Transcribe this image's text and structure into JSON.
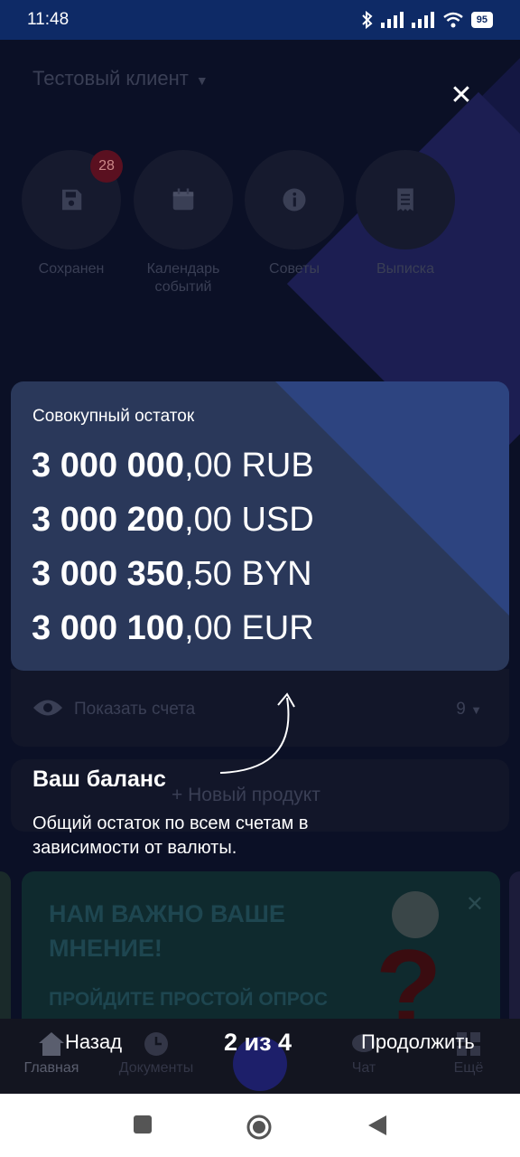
{
  "status_bar": {
    "time": "11:48",
    "battery": "95"
  },
  "header": {
    "client_name": "Тестовый клиент"
  },
  "quick_actions": [
    {
      "label": "Сохранен",
      "icon": "save-icon",
      "badge": "28"
    },
    {
      "label": "Календарь событий",
      "icon": "calendar-icon"
    },
    {
      "label": "Советы",
      "icon": "info-icon"
    },
    {
      "label": "Выписка",
      "icon": "receipt-icon"
    }
  ],
  "balance_card": {
    "caption": "Совокупный остаток",
    "rows": [
      {
        "int": "3 000 000",
        "frac": ",00 RUB"
      },
      {
        "int": "3 000 200",
        "frac": ",00 USD"
      },
      {
        "int": "3 000 350",
        "frac": ",50 BYN"
      },
      {
        "int": "3 000 100",
        "frac": ",00 EUR"
      }
    ]
  },
  "accounts": {
    "label": "Показать счета",
    "count": "9"
  },
  "new_product": {
    "label": "Новый продукт"
  },
  "tooltip": {
    "title": "Ваш баланс",
    "description": "Общий остаток по всем счетам в зависимости от валюты."
  },
  "promo": {
    "headline": "НАМ ВАЖНО ВАШЕ МНЕНИЕ!",
    "subline": "ПРОЙДИТЕ ПРОСТОЙ ОПРОС"
  },
  "tab_bar": {
    "items": [
      {
        "label": "Главная",
        "icon": "home-icon"
      },
      {
        "label": "Документы",
        "icon": "clock-icon"
      },
      {
        "label": "Чат",
        "icon": "chat-icon"
      },
      {
        "label": "Ещё",
        "icon": "grid-icon"
      }
    ]
  },
  "tour": {
    "back": "Назад",
    "counter": "2 из 4",
    "next": "Продолжить"
  },
  "colors": {
    "card_bg": "#2a385a",
    "status_bar": "#0e2a66",
    "badge": "#c8102e"
  }
}
